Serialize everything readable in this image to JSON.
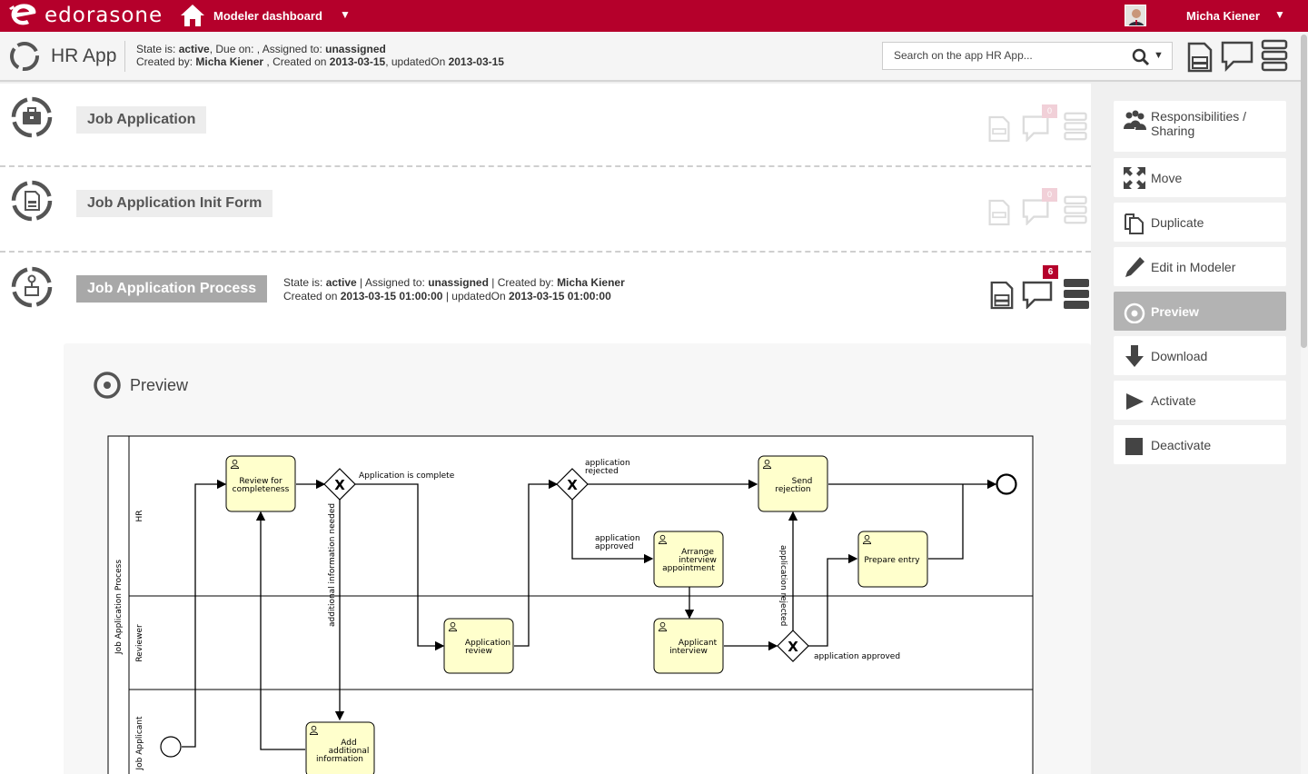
{
  "topbar": {
    "brand": "edorasone",
    "dashboard_label": "Modeler dashboard",
    "dashboard_caret": "▼",
    "user_name": "Micha Kiener",
    "user_caret": "▼",
    "brand_color": "#b5002b"
  },
  "app": {
    "title": "HR App",
    "meta_line1": {
      "p1": "State is: ",
      "state": "active",
      "p2": ", Due on: , Assigned to: ",
      "assigned": "unassigned"
    },
    "meta_line2": {
      "p1": "Created by: ",
      "creator": "Micha Kiener",
      "p2": " , Created on ",
      "created": "2013-03-15",
      "p3": ", updatedOn ",
      "updated": "2013-03-15"
    },
    "search_placeholder": "Search on the app HR App...",
    "search_caret": "▼"
  },
  "items": [
    {
      "title": "Job Application",
      "badge": "0"
    },
    {
      "title": "Job Application Init Form",
      "badge": "0"
    },
    {
      "title": "Job Application Process",
      "badge": "6",
      "meta_line1": {
        "p1": "State is: ",
        "state": "active",
        "p2": " | Assigned to: ",
        "assigned": "unassigned",
        "p3": " | Created by: ",
        "creator": "Micha Kiener"
      },
      "meta_line2": {
        "p1": "Created on ",
        "created": "2013-03-15 01:00:00",
        "p2": " | updatedOn ",
        "updated": "2013-03-15 01:00:00"
      }
    }
  ],
  "preview": {
    "title": "Preview",
    "diagram": {
      "pool": "Job Application Process",
      "lanes": [
        "HR",
        "Reviewer",
        "Job Applicant"
      ],
      "tasks": [
        [
          "Review for",
          "completeness"
        ],
        [
          "Application",
          "review"
        ],
        [
          "Add",
          "additional",
          "information"
        ],
        [
          "Arrange",
          "interview",
          "appointment"
        ],
        [
          "Applicant",
          "interview"
        ],
        [
          "Send",
          "rejection"
        ],
        [
          "Prepare entry"
        ]
      ],
      "labels": {
        "complete": "Application is complete",
        "additional": "additional information needed",
        "rejected_top": [
          "application",
          "rejected"
        ],
        "approved_mid": [
          "application",
          "approved"
        ],
        "rejected_vertical": "application rejected",
        "approved_bottom": "application approved"
      }
    }
  },
  "sidebar": [
    {
      "label": "Responsibilities / Sharing",
      "icon": "people-icon"
    },
    {
      "label": "Move",
      "icon": "move-icon"
    },
    {
      "label": "Duplicate",
      "icon": "duplicate-icon"
    },
    {
      "label": "Edit in Modeler",
      "icon": "pencil-icon"
    },
    {
      "label": "Preview",
      "icon": "preview-icon",
      "active": true
    },
    {
      "label": "Download",
      "icon": "download-icon"
    },
    {
      "label": "Activate",
      "icon": "play-icon"
    },
    {
      "label": "Deactivate",
      "icon": "stop-icon"
    }
  ]
}
